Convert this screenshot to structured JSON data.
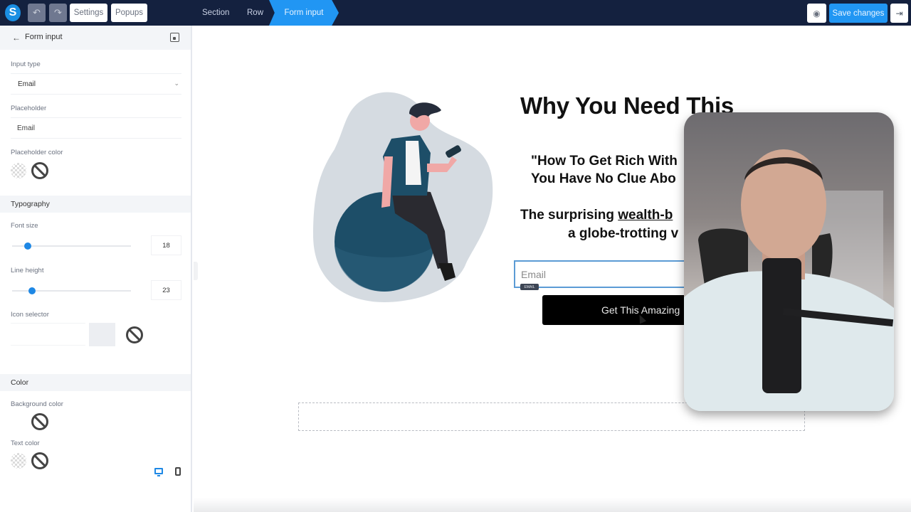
{
  "topbar": {
    "logo_letter": "S",
    "undo_icon": "↶",
    "redo_icon": "↷",
    "settings_label": "Settings",
    "popups_label": "Popups",
    "breadcrumbs": [
      "Section",
      "Row",
      "Form input"
    ],
    "preview_icon": "◉",
    "save_label": "Save changes",
    "exit_icon": "⇥"
  },
  "sidebar": {
    "back_icon": "←",
    "title": "Form input",
    "input_type_label": "Input type",
    "input_type_value": "Email",
    "input_type_chevron": "⌄",
    "placeholder_label": "Placeholder",
    "placeholder_value": "Email",
    "placeholder_color_label": "Placeholder color",
    "typography_heading": "Typography",
    "font_size_label": "Font size",
    "font_size_value": "18",
    "font_size_slider_percent": 13,
    "line_height_label": "Line height",
    "line_height_value": "23",
    "line_height_slider_percent": 17,
    "icon_selector_label": "Icon selector",
    "color_heading": "Color",
    "background_color_label": "Background color",
    "text_color_label": "Text color"
  },
  "canvas": {
    "headline": "Why You Need This",
    "quote_lines": [
      "\"How To Get Rich With",
      "You Have No Clue Abo"
    ],
    "sub_prefix": "The surprising ",
    "sub_link": "wealth-b",
    "sub_line2": "a globe-trotting v",
    "email_placeholder": "Email",
    "email_tag": "EMAIL",
    "cta_label": "Get This Amazing"
  },
  "colors": {
    "topbar_bg": "#14213f",
    "accent": "#2196f3",
    "cta_bg": "#000000",
    "illustration_navy": "#1d4e68",
    "illustration_blob": "#d5dbe1"
  }
}
